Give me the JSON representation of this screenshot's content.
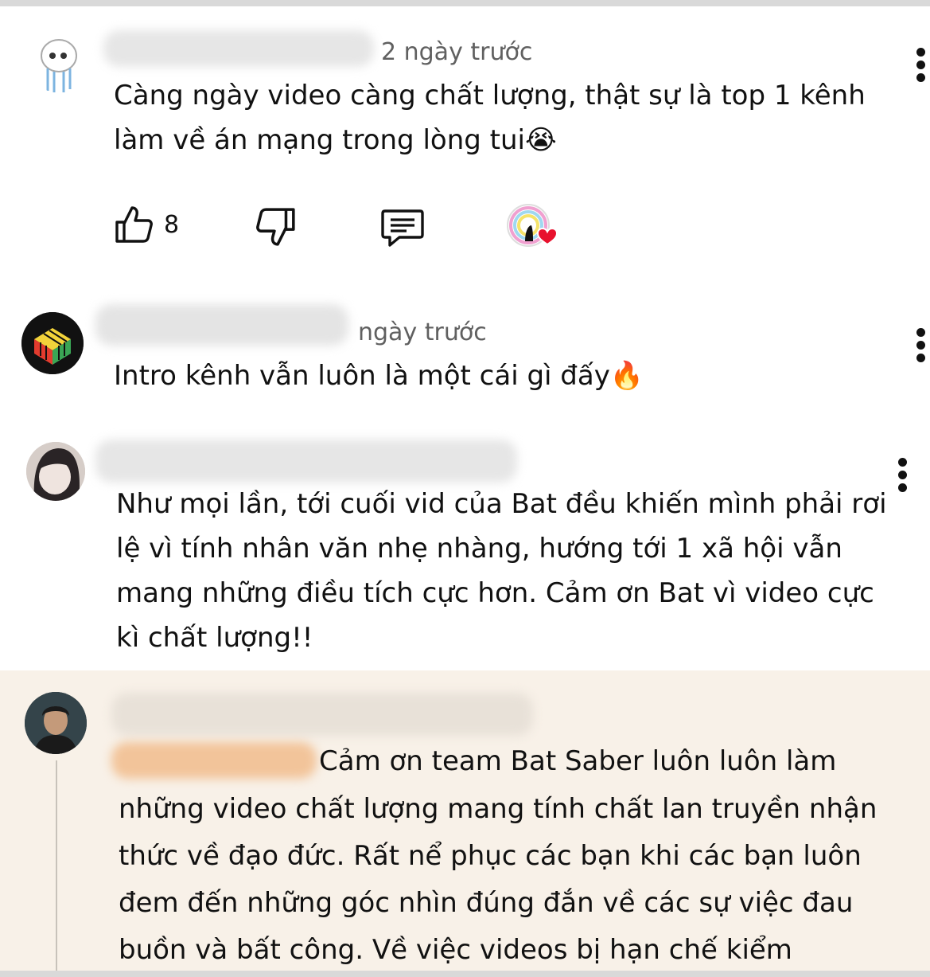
{
  "comments": [
    {
      "time": "2 ngày trước",
      "text": "Càng ngày video càng chất lượng, thật sự là top 1 kênh làm về án mạng trong lòng tui😭",
      "likes": "8"
    },
    {
      "time": "ngày trước",
      "text": "Intro kênh vẫn luôn là một cái gì đấy🔥"
    },
    {
      "text": "Như mọi lần, tới cuối vid của Bat đều khiến mình phải rơi lệ vì tính nhân văn nhẹ nhàng, hướng tới 1 xã hội vẫn mang những điều tích cực hơn. Cảm ơn Bat vì video cực kì chất lượng!!"
    },
    {
      "text_first_line": "Cảm ơn team Bat Saber luôn luôn làm",
      "text_rest": "những video chất lượng mang tính chất lan truyền nhận thức về đạo đức. Rất nể phục các bạn khi các bạn luôn đem đến những góc nhìn đúng đắn về các sự việc đau buồn và bất công. Về việc videos bị hạn chế kiểm"
    }
  ],
  "icons": [
    "like-icon",
    "dislike-icon",
    "reply-icon",
    "creator-heart-icon",
    "more-options-icon"
  ],
  "colors": {
    "highlight_bg": "#f8f1e8",
    "heart": "#e8112d",
    "meta": "#606060"
  }
}
